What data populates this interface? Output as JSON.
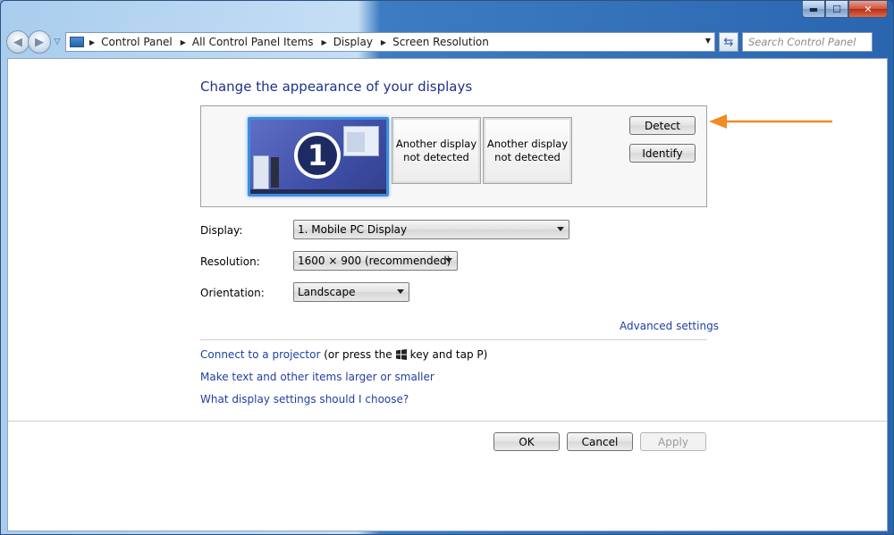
{
  "window": {
    "caption_minimize": "▬",
    "caption_maximize": "☐",
    "caption_close": "✕"
  },
  "navbar": {
    "breadcrumbs": [
      "Control Panel",
      "All Control Panel Items",
      "Display",
      "Screen Resolution"
    ],
    "search_placeholder": "Search Control Panel",
    "icons": [
      "back-icon",
      "forward-icon",
      "history-dropdown-icon",
      "monitor-icon",
      "refresh-icon"
    ]
  },
  "main": {
    "title": "Change the appearance of your displays",
    "monitor1_number": "1",
    "monitor2_text": "Another display not detected",
    "monitor3_text": "Another display not detected",
    "detect_label": "Detect",
    "identify_label": "Identify",
    "display_label": "Display:",
    "display_value": "1. Mobile PC Display",
    "resolution_label": "Resolution:",
    "resolution_value": "1600 × 900 (recommended)",
    "orientation_label": "Orientation:",
    "orientation_value": "Landscape",
    "advanced_settings": "Advanced settings",
    "projector_link": "Connect to a projector",
    "projector_suffix_1": "(or press the",
    "projector_suffix_2": "key and tap P)",
    "text_size_link": "Make text and other items larger or smaller",
    "help_link": "What display settings should I choose?",
    "ok_label": "OK",
    "cancel_label": "Cancel",
    "apply_label": "Apply",
    "accent_arrow_color": "#f08a24",
    "link_color": "#1f3fa0"
  }
}
